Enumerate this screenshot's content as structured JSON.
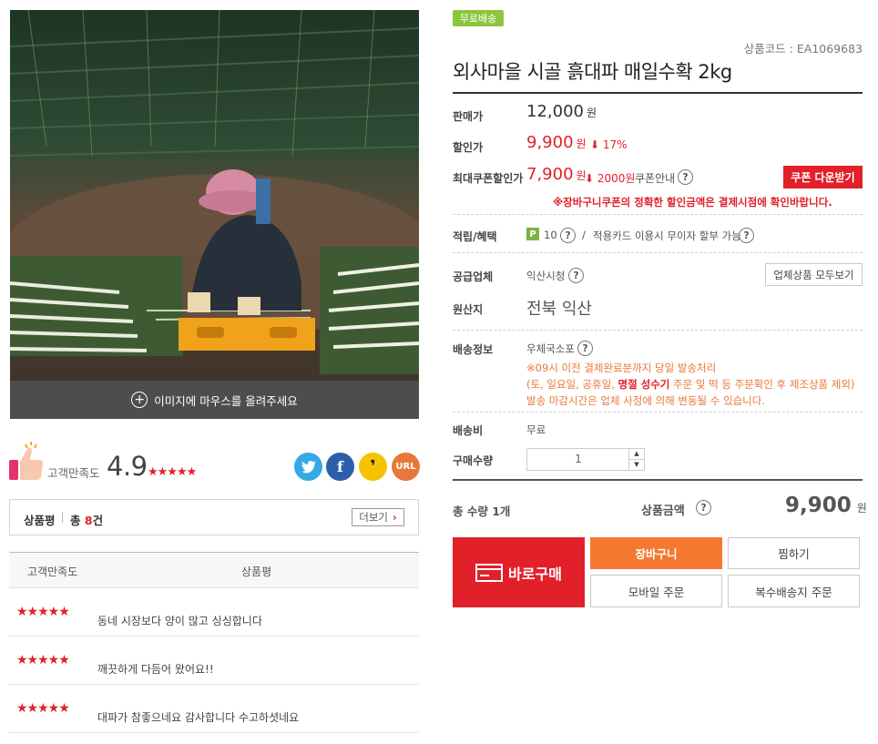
{
  "image": {
    "hover_text": "이미지에 마우스를 올려주세요"
  },
  "rating": {
    "label": "고객만족도",
    "value": "4.9",
    "stars": "★★★★★"
  },
  "share": {
    "twitter": "twitter-icon",
    "facebook": "f",
    "kakao": "kakaostory-icon",
    "url": "URL"
  },
  "reviews": {
    "title": "상품평",
    "count_prefix": "총",
    "count": "8",
    "count_suffix": "건",
    "more": "더보기",
    "col_rating": "고객만족도",
    "col_review": "상품평",
    "rows": [
      {
        "stars": "★★★★★",
        "text": "동네 시장보다 양이 많고 싱싱합니다"
      },
      {
        "stars": "★★★★★",
        "text": "깨끗하게 다듬어 왔어요!!"
      },
      {
        "stars": "★★★★★",
        "text": "대파가 참좋으네요 감사합니다 수고하셧네요"
      }
    ]
  },
  "product": {
    "badge": "무료배송",
    "code": "상품코드 : EA1069683",
    "title": "외사마을 시골 흙대파 매일수확 2kg",
    "price_label": "판매가",
    "price": "12,000",
    "won": "원",
    "sale_label": "할인가",
    "sale_price": "9,900",
    "sale_pct": "17%",
    "coupon_label": "최대쿠폰할인가",
    "coupon_price": "7,900",
    "coupon_discount": "2000원",
    "coupon_guide": "쿠폰안내",
    "coupon_button": "쿠폰 다운받기",
    "coupon_note": "※장바구니쿠폰의 정확한 할인금액은 결제시점에 확인바랍니다.",
    "points_label": "적립/혜택",
    "points_badge": "P",
    "points": "10",
    "points_sep": "/",
    "card_text": "적용카드 이용시 무이자 할부 가능",
    "supplier_label": "공급업체",
    "supplier": "익산시청",
    "supplier_button": "업체상품 모두보기",
    "origin_label": "원산지",
    "origin": "전북 익산",
    "shipping_label": "배송정보",
    "shipping_method": "우체국소포",
    "shipping_note_1": "※09시 이전 결제완료분까지 당일 발송처리",
    "shipping_note_2a": "(토, 일요일, 공휴일, ",
    "shipping_note_2b": "명절 성수기",
    "shipping_note_2c": " 주문 및 떡 등 주문확인 후 제조상품 제외)",
    "shipping_note_3": "발송 마감시간은 업체 사정에 의해 변동될 수 있습니다.",
    "fee_label": "배송비",
    "fee": "무료",
    "qty_label": "구매수량",
    "qty": "1",
    "total_qty": "총 수량 1개",
    "total_label": "상품금액",
    "total": "9,900"
  },
  "actions": {
    "buy": "바로구매",
    "cart": "장바구니",
    "wish": "찜하기",
    "mobile": "모바일 주문",
    "multi": "복수배송지 주문"
  },
  "colors": {
    "accent_red": "#e1202a",
    "orange": "#f37930",
    "badge_green": "#8cc63e"
  }
}
